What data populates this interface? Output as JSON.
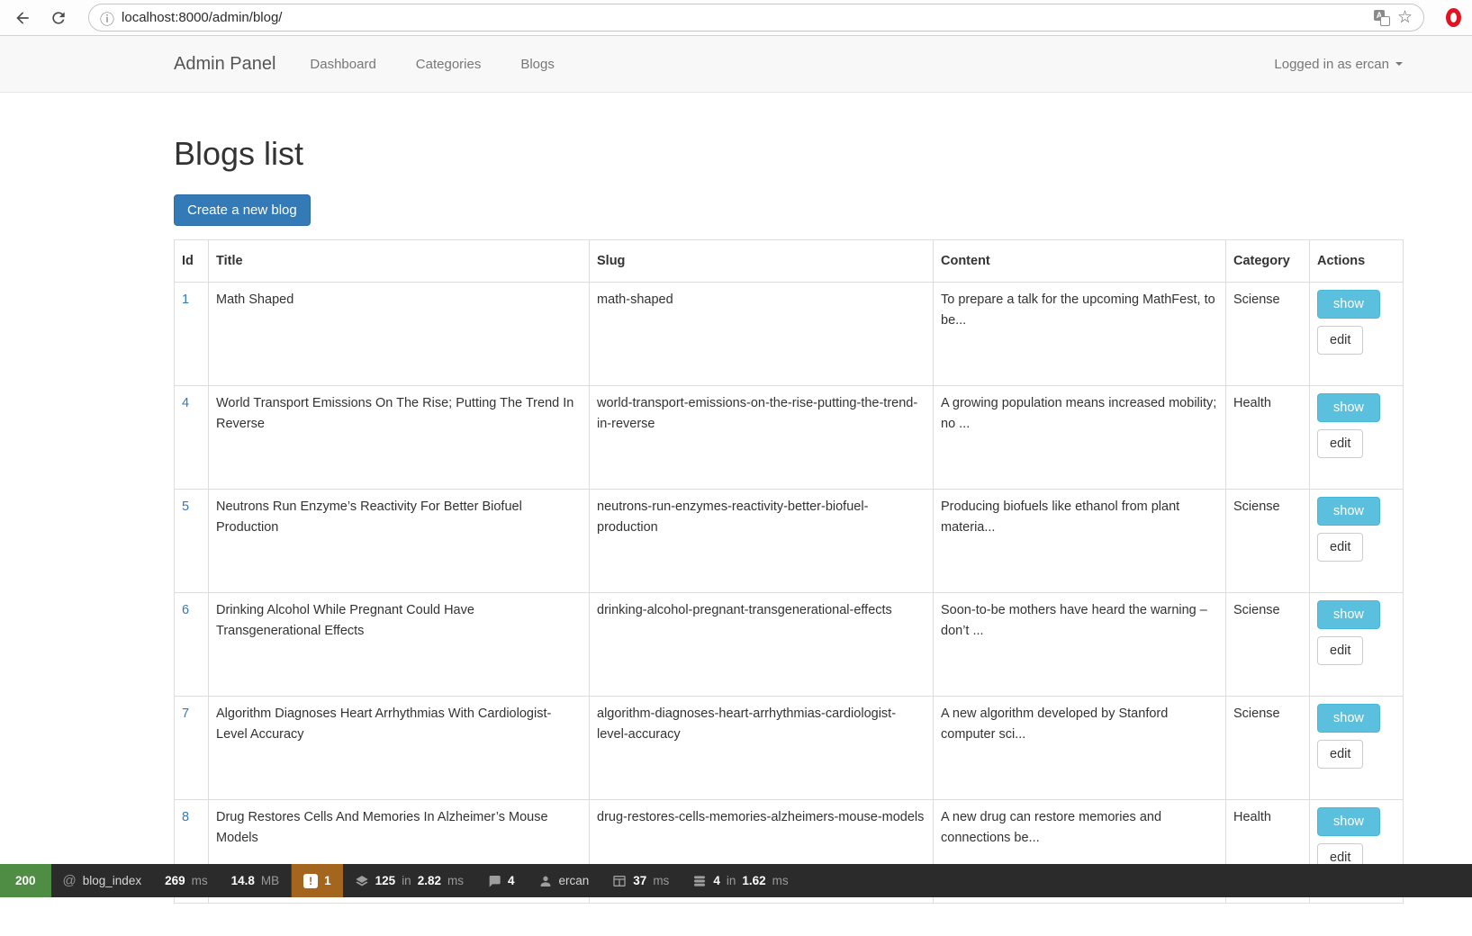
{
  "browser": {
    "url": "localhost:8000/admin/blog/",
    "info_icon": "ⓘ",
    "star_icon": "☆",
    "translate_icon_letter": "A"
  },
  "navbar": {
    "brand": "Admin Panel",
    "links": [
      "Dashboard",
      "Categories",
      "Blogs"
    ],
    "user": "Logged in as ercan"
  },
  "page": {
    "title": "Blogs list",
    "create_button": "Create a new blog"
  },
  "table": {
    "headers": [
      "Id",
      "Title",
      "Slug",
      "Content",
      "Category",
      "Actions"
    ],
    "show_label": "show",
    "edit_label": "edit",
    "rows": [
      {
        "id": "1",
        "title": "Math Shaped",
        "slug": "math-shaped",
        "content": "To prepare a talk for the upcoming MathFest, to be...",
        "category": "Sciense"
      },
      {
        "id": "4",
        "title": "World Transport Emissions On The Rise; Putting The Trend In Reverse",
        "slug": "world-transport-emissions-on-the-rise-putting-the-trend-in-reverse",
        "content": "A growing population means increased mobility; no ...",
        "category": "Health"
      },
      {
        "id": "5",
        "title": "Neutrons Run Enzyme’s Reactivity For Better Biofuel Production",
        "slug": "neutrons-run-enzymes-reactivity-better-biofuel-production",
        "content": "Producing biofuels like ethanol from plant materia...",
        "category": "Sciense"
      },
      {
        "id": "6",
        "title": "Drinking Alcohol While Pregnant Could Have Transgenerational Effects",
        "slug": "drinking-alcohol-pregnant-transgenerational-effects",
        "content": "Soon-to-be mothers have heard the warning – don’t ...",
        "category": "Sciense"
      },
      {
        "id": "7",
        "title": "Algorithm Diagnoses Heart Arrhythmias With Cardiologist-Level Accuracy",
        "slug": "algorithm-diagnoses-heart-arrhythmias-cardiologist-level-accuracy",
        "content": "A new algorithm developed by Stanford computer sci...",
        "category": "Sciense"
      },
      {
        "id": "8",
        "title": "Drug Restores Cells And Memories In Alzheimer’s Mouse Models",
        "slug": "drug-restores-cells-memories-alzheimers-mouse-models",
        "content": "A new drug can restore memories and connections be...",
        "category": "Health"
      }
    ]
  },
  "debugbar": {
    "status_code": "200",
    "route_icon": "@",
    "route": "blog_index",
    "time_value": "269",
    "time_unit": "ms",
    "memory_value": "14.8",
    "memory_unit": "MB",
    "warning_glyph": "!",
    "warning_count": "1",
    "queries_count": "125",
    "in_word": "in",
    "queries_time": "2.82",
    "queries_unit": "ms",
    "views_count": "4",
    "auth_user": "ercan",
    "gate_time": "37",
    "gate_unit": "ms",
    "session_count": "4",
    "session_time": "1.62",
    "session_unit": "ms"
  },
  "colors": {
    "accent_blue": "#337ab7",
    "info_button": "#5bc0de",
    "status_green": "#4e8d43",
    "warning_orange": "#a4651e",
    "opera_red": "#e2131f"
  }
}
